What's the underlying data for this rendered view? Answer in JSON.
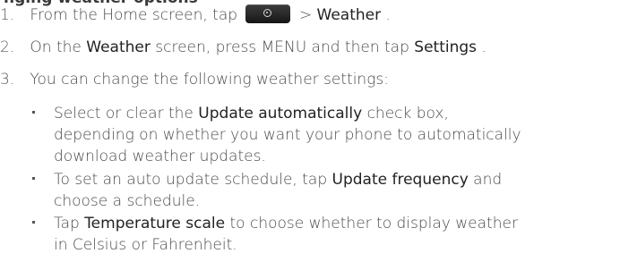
{
  "heading_partial": "nging weather options",
  "steps": [
    {
      "number": "1.",
      "pre": "From the Home screen, tap",
      "icon": "all-apps-icon",
      "post": " > ",
      "ui": "Weather",
      "end": "."
    },
    {
      "number": "2.",
      "pre": "On the ",
      "ui1": "Weather",
      "mid": " screen, press MENU and then tap ",
      "ui2": "Settings",
      "end": "."
    },
    {
      "number": "3.",
      "text": "You can change the following weather settings:"
    }
  ],
  "bullets": [
    {
      "pre": "Select or clear the ",
      "ui": "Update automatically",
      "post_line1": " check box,",
      "line2": "depending on whether you want your phone to automatically",
      "line3": "download weather updates."
    },
    {
      "line1_pre": "To set an auto update schedule, tap ",
      "ui": "Update frequency",
      "line1_post": " and",
      "line2": "choose a schedule."
    },
    {
      "line1_pre": "Tap ",
      "ui": "Temperature scale",
      "line1_post": " to choose whether to display weather",
      "line2": "in Celsius or Fahrenheit."
    }
  ]
}
